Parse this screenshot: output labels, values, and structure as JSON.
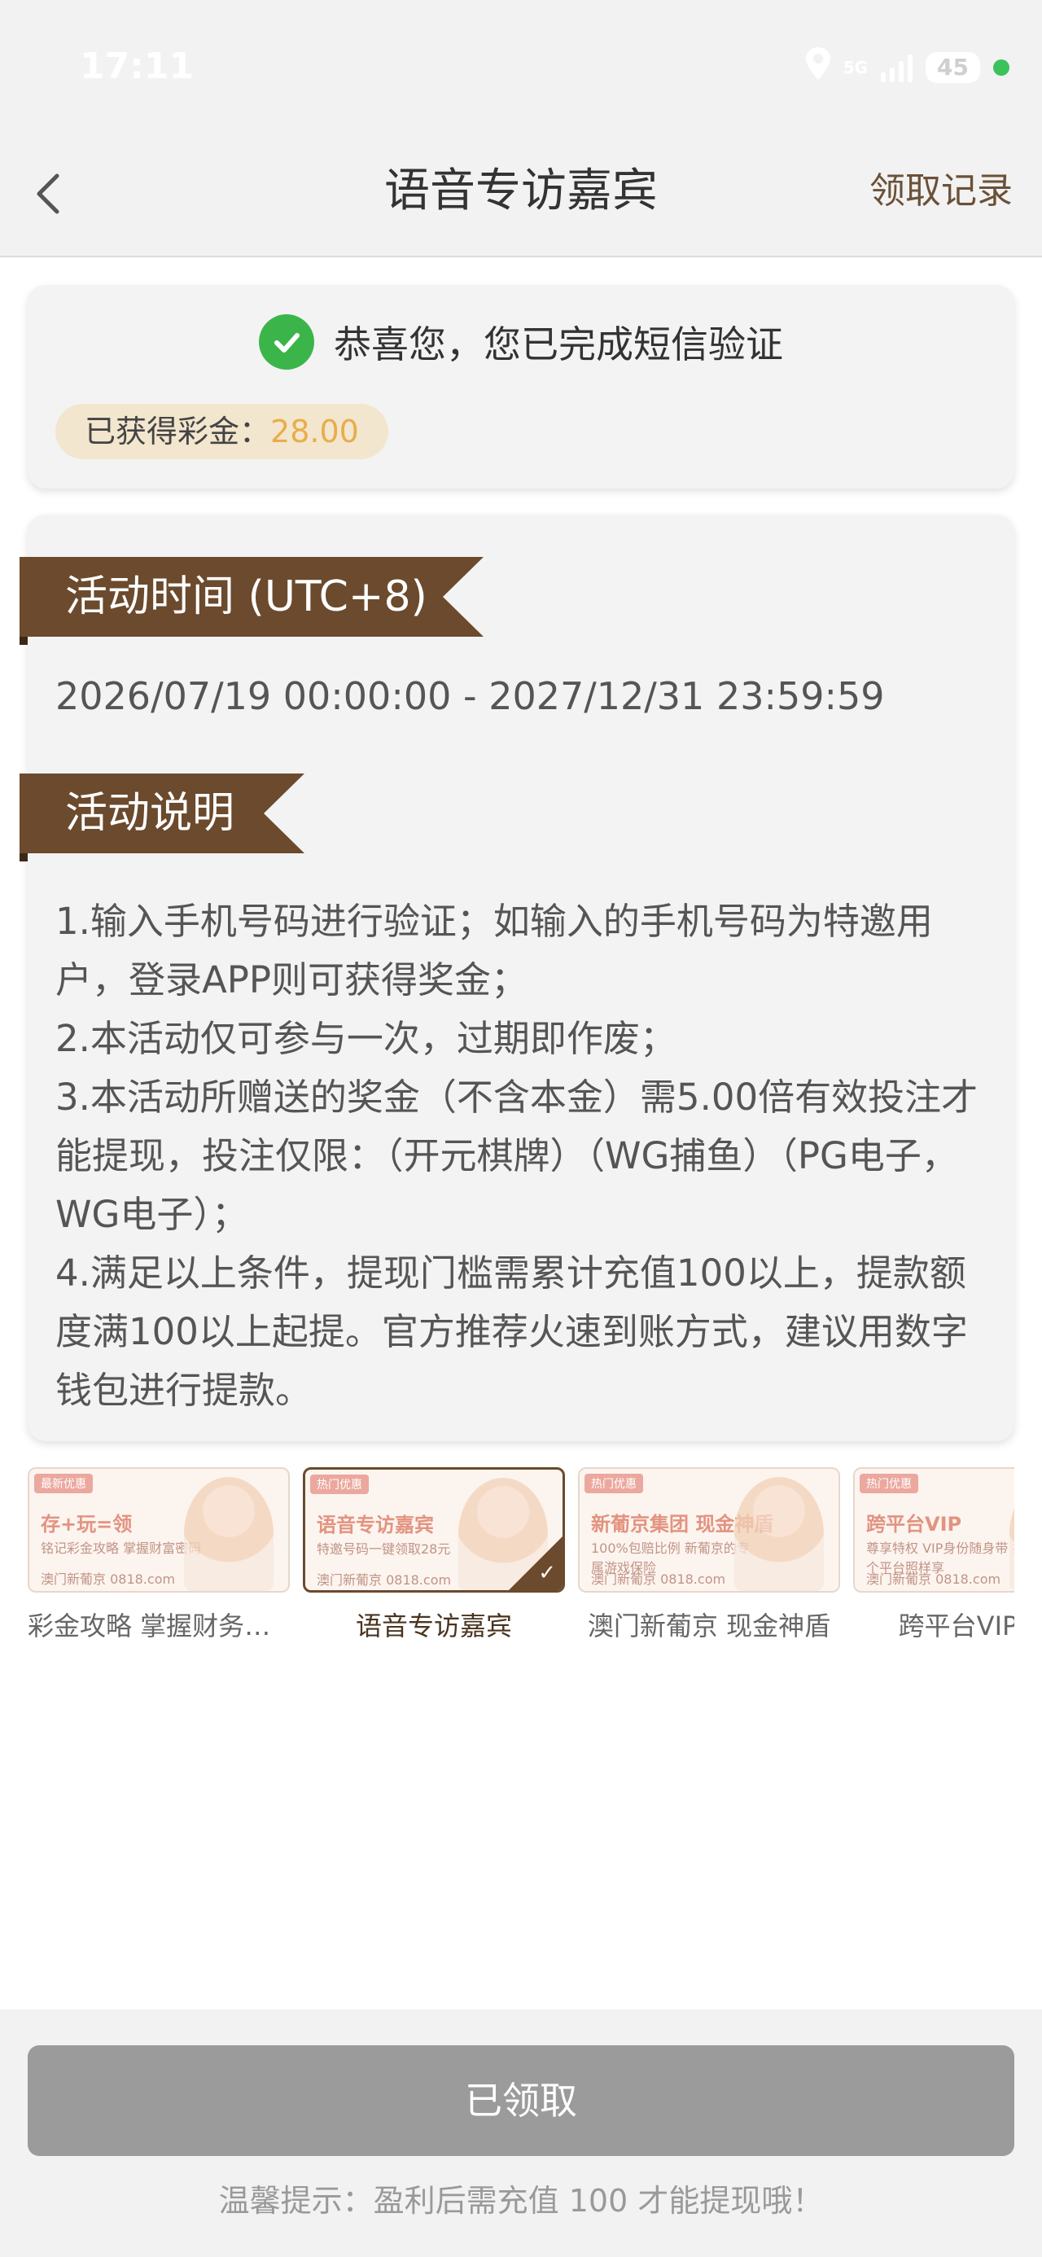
{
  "status_bar": {
    "time": "17:11",
    "network": "5G",
    "battery": "45"
  },
  "nav": {
    "title": "语音专访嘉宾",
    "record_link": "领取记录"
  },
  "verify_card": {
    "message": "恭喜您，您已完成短信验证",
    "bonus_label": "已获得彩金：",
    "bonus_value": "28.00"
  },
  "info_card": {
    "time_heading": "活动时间 (UTC+8)",
    "time_range": "2026/07/19 00:00:00 - 2027/12/31 23:59:59",
    "desc_heading": "活动说明",
    "rules": [
      "1.输入手机号码进行验证；如输入的手机号码为特邀用户，登录APP则可获得奖金；",
      "2.本活动仅可参与一次，过期即作废；",
      "3.本活动所赠送的奖金（不含本金）需5.00倍有效投注才能提现，投注仅限：（开元棋牌）（WG捕鱼）（PG电子，WG电子）；",
      "4.满足以上条件，提现门槛需累计充值100以上，提款额度满100以上起提。官方推荐火速到账方式，建议用数字钱包进行提款。"
    ]
  },
  "promos": [
    {
      "tag": "最新优惠",
      "headline": "存+玩=领",
      "sub": "铭记彩金攻略 掌握财富密码",
      "site": "澳门新葡京 0818.com",
      "caption": "彩金攻略 掌握财务密码",
      "active": false
    },
    {
      "tag": "热门优惠",
      "headline": "语音专访嘉宾",
      "sub": "特邀号码一键领取28元",
      "site": "澳门新葡京 0818.com",
      "caption": "语音专访嘉宾",
      "active": true
    },
    {
      "tag": "热门优惠",
      "headline": "新葡京集团 现金神盾",
      "sub": "100%包赔比例 新葡京的专属游戏保险",
      "site": "澳门新葡京 0818.com",
      "caption": "澳门新葡京 现金神盾",
      "active": false
    },
    {
      "tag": "热门优惠",
      "headline": "跨平台VIP",
      "sub": "尊享特权 VIP身份随身带 换个平台照样享",
      "site": "澳门新葡京 0818.com",
      "caption": "跨平台VIP尊享",
      "active": false
    }
  ],
  "bottom": {
    "claim_button": "已领取",
    "tip": "温馨提示：盈利后需充值 100 才能提现哦！"
  },
  "colors": {
    "accent_brown": "#6b4a2d",
    "bonus_gold": "#e8ad4a",
    "check_green": "#3bb54a",
    "disabled_gray": "#9b9b9b"
  }
}
